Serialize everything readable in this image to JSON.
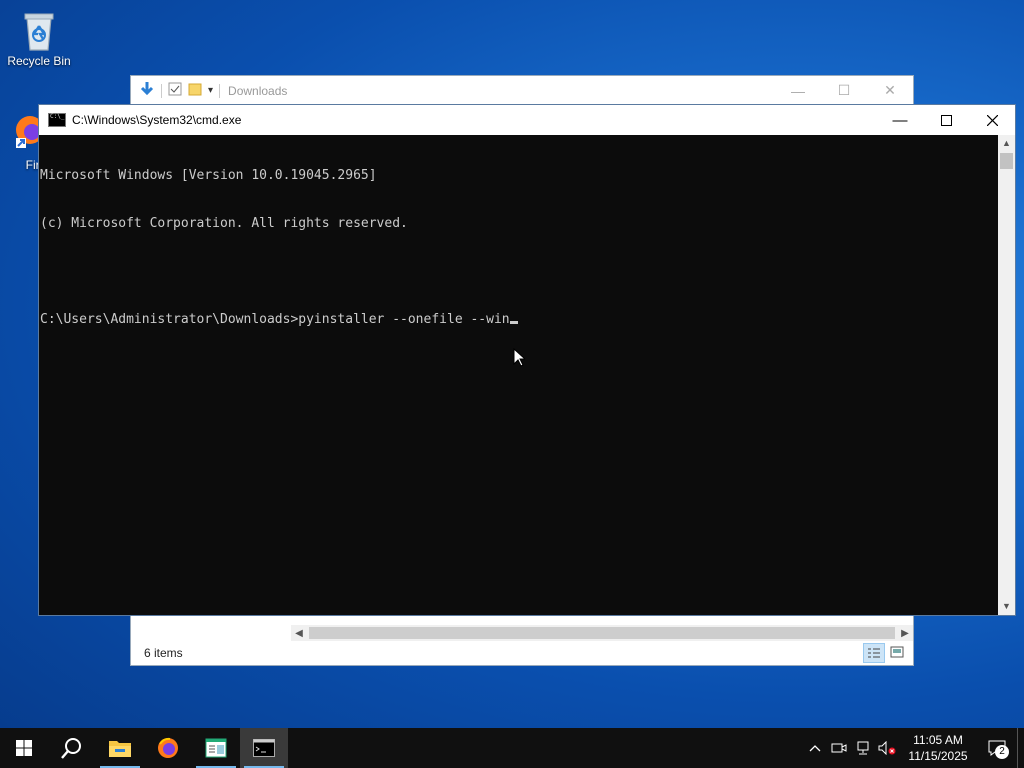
{
  "desktop": {
    "icons": [
      {
        "label": "Recycle Bin"
      },
      {
        "label": "Fire"
      }
    ]
  },
  "explorer": {
    "title": "Downloads",
    "status_count": "6 items"
  },
  "cmd": {
    "title": "C:\\Windows\\System32\\cmd.exe",
    "lines": [
      "Microsoft Windows [Version 10.0.19045.2965]",
      "(c) Microsoft Corporation. All rights reserved.",
      "",
      "C:\\Users\\Administrator\\Downloads>pyinstaller --onefile --win"
    ]
  },
  "taskbar": {
    "icons": [
      "windows-start-icon",
      "search-icon",
      "file-explorer-icon",
      "firefox-icon",
      "app-window-icon",
      "command-prompt-icon"
    ],
    "clock_time": "11:05 AM",
    "clock_date": "11/15/2025",
    "notification_count": "2"
  },
  "colors": {
    "console_bg": "#0c0c0c",
    "console_fg": "#cccccc",
    "taskbar_bg": "#101010",
    "accent": "#76b9ed"
  }
}
